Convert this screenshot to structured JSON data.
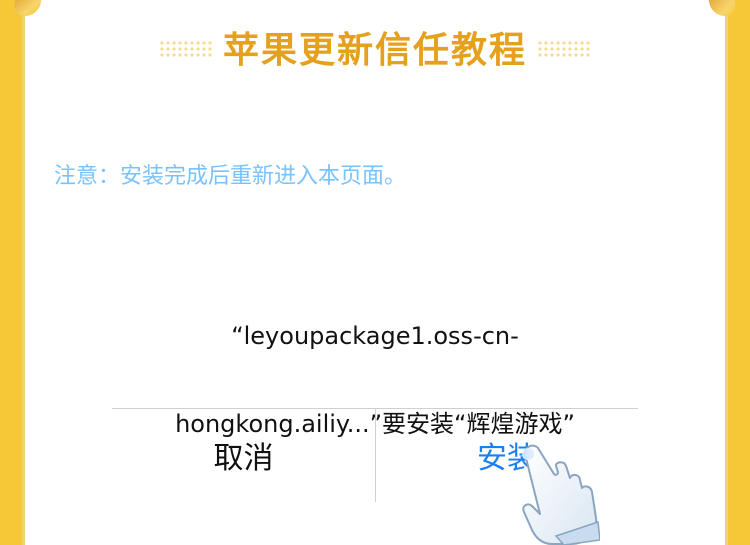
{
  "header": {
    "title": "苹果更新信任教程"
  },
  "notice": {
    "text": "注意：安装完成后重新进入本页面。"
  },
  "dialog": {
    "message_line1": "“leyoupackage1.oss-cn-",
    "message_line2": "hongkong.ailiy...”要安装“辉煌游戏”",
    "cancel_label": "取消",
    "install_label": "安装"
  },
  "icons": {
    "pointer": "pointing-hand-icon"
  },
  "colors": {
    "frame_yellow": "#f6c838",
    "title_gold": "#e5a11d",
    "notice_blue": "#78c3ff",
    "install_blue": "#1b7ff2"
  }
}
